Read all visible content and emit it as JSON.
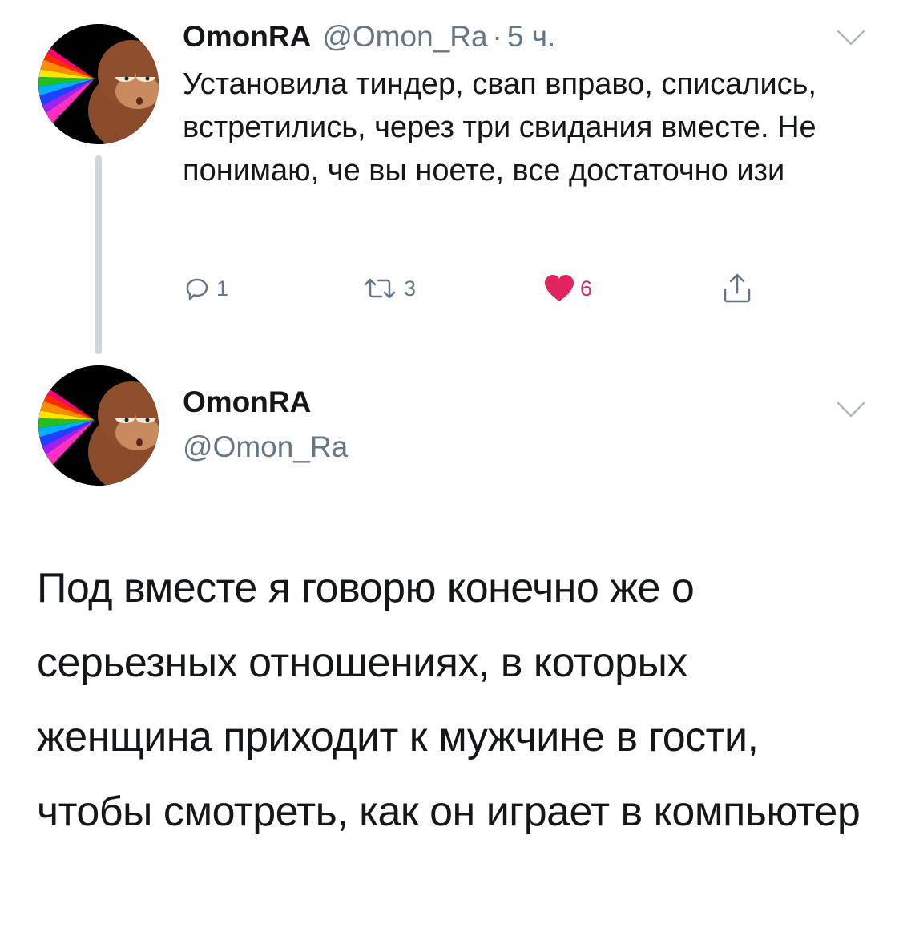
{
  "tweet1": {
    "author_name": "OmonRA",
    "author_handle": "@Omon_Ra",
    "separator": "·",
    "time": "5 ч.",
    "text": "Установила тиндер, свап вправо, списались, встретились, через три свидания вместе. Не понимаю, че вы ноете, все достаточно изи",
    "actions": {
      "reply_icon": "reply-icon",
      "reply_count": "1",
      "retweet_icon": "retweet-icon",
      "retweet_count": "3",
      "like_icon": "heart-icon",
      "like_count": "6",
      "share_icon": "share-icon"
    }
  },
  "tweet2": {
    "author_name": "OmonRA",
    "author_handle": "@Omon_Ra",
    "text": "Под вместе я говорю конечно же о серьезных отношениях, в которых женщина приходит к мужчине в гости, чтобы смотреть, как он играет в компьютер"
  },
  "colors": {
    "text": "#14171a",
    "secondary_text": "#657786",
    "like": "#e0245e",
    "thread_line": "#ccd6dd",
    "chevron": "#aab8c2"
  }
}
